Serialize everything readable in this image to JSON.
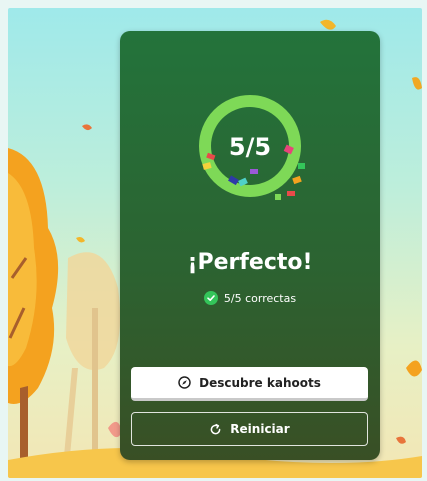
{
  "result": {
    "score_text": "5/5",
    "title": "¡Perfecto!",
    "correct_text": "5/5 correctas",
    "score_fraction": 1.0
  },
  "buttons": {
    "discover_label": "Descubre kahoots",
    "restart_label": "Reiniciar"
  },
  "icons": {
    "discover": "compass-icon",
    "restart": "restart-icon",
    "correct": "check-circle-icon"
  },
  "colors": {
    "card_top": "#23733b",
    "card_bottom": "#394f25",
    "ring": "#7ed957",
    "check": "#34c55a"
  }
}
